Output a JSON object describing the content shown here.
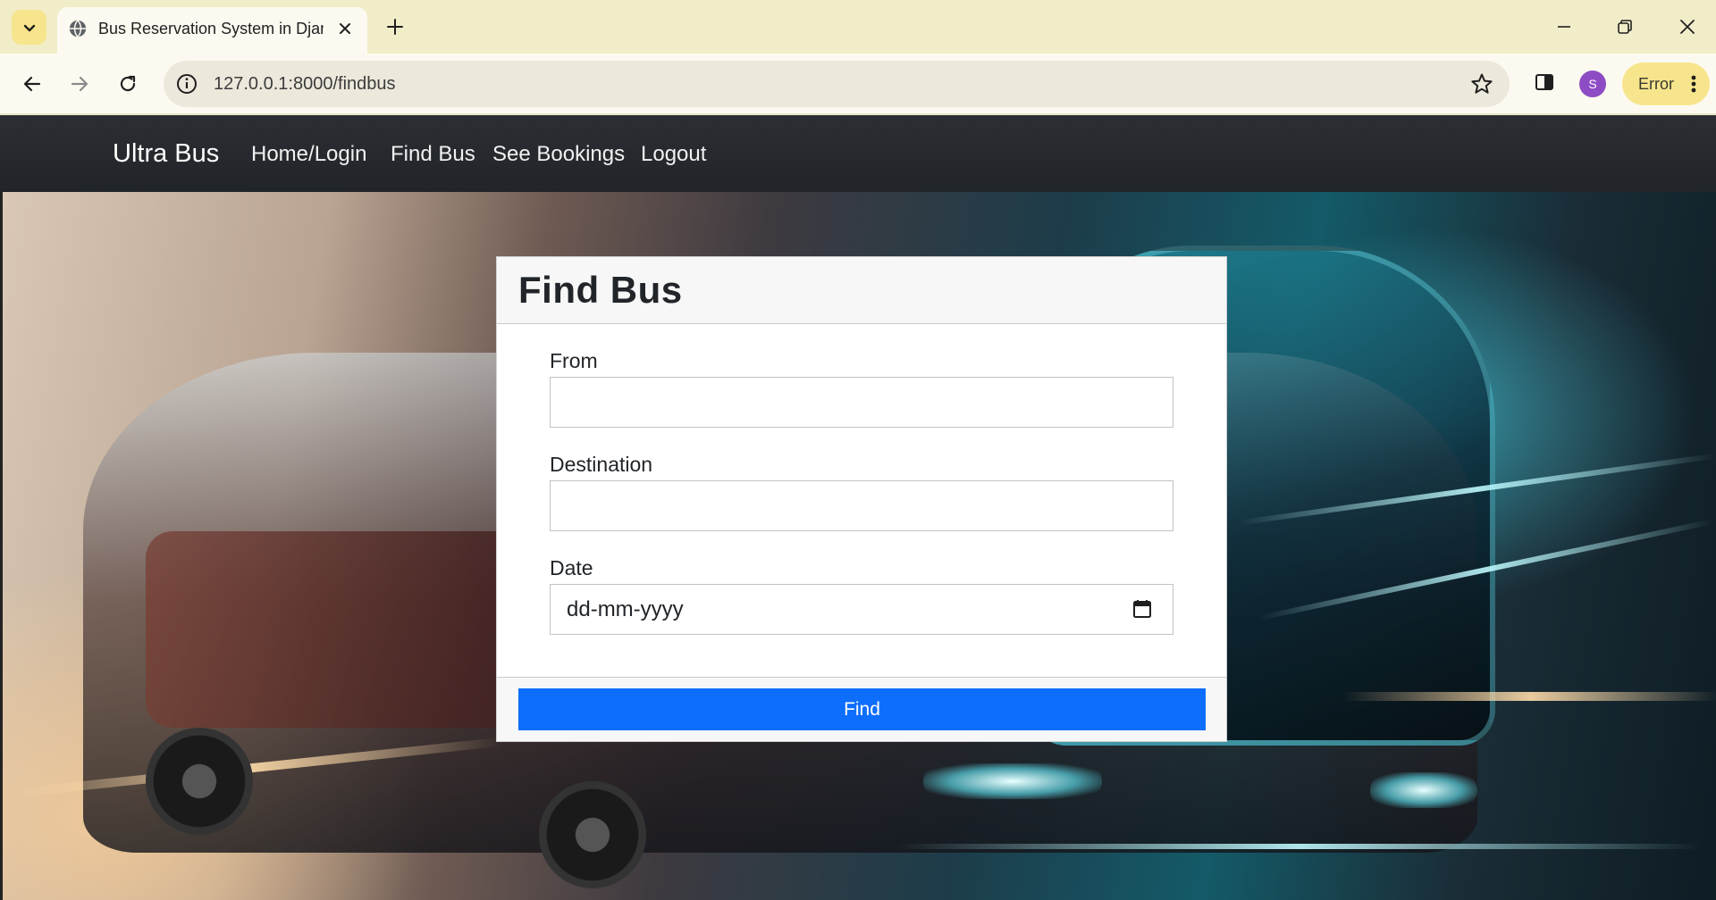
{
  "browser": {
    "tab_title": "Bus Reservation System in Django",
    "url": "127.0.0.1:8000/findbus",
    "profile_initial": "S",
    "error_label": "Error"
  },
  "icons": {
    "tab_search": "chevron-down-icon",
    "tab_favicon": "globe-icon",
    "tab_close": "close-icon",
    "new_tab": "plus-icon",
    "minimize": "minimize-icon",
    "restore": "restore-icon",
    "close_window": "close-icon",
    "back": "arrow-left-icon",
    "forward": "arrow-right-icon",
    "reload": "reload-icon",
    "site_info": "info-icon",
    "bookmark": "star-icon",
    "side_panel": "side-panel-icon",
    "menu": "kebab-menu-icon",
    "calendar": "calendar-icon"
  },
  "navbar": {
    "brand": "Ultra Bus",
    "links": [
      "Home/Login",
      "Find Bus",
      "See Bookings",
      "Logout"
    ]
  },
  "form": {
    "title": "Find Bus",
    "fields": [
      {
        "label": "From",
        "value": ""
      },
      {
        "label": "Destination",
        "value": ""
      },
      {
        "label": "Date",
        "value": "dd-mm-yyyy"
      }
    ],
    "submit_label": "Find"
  },
  "colors": {
    "navbar_bg": "#212529",
    "primary_button": "#0d6efd",
    "chrome_bg": "#f1edc9"
  }
}
